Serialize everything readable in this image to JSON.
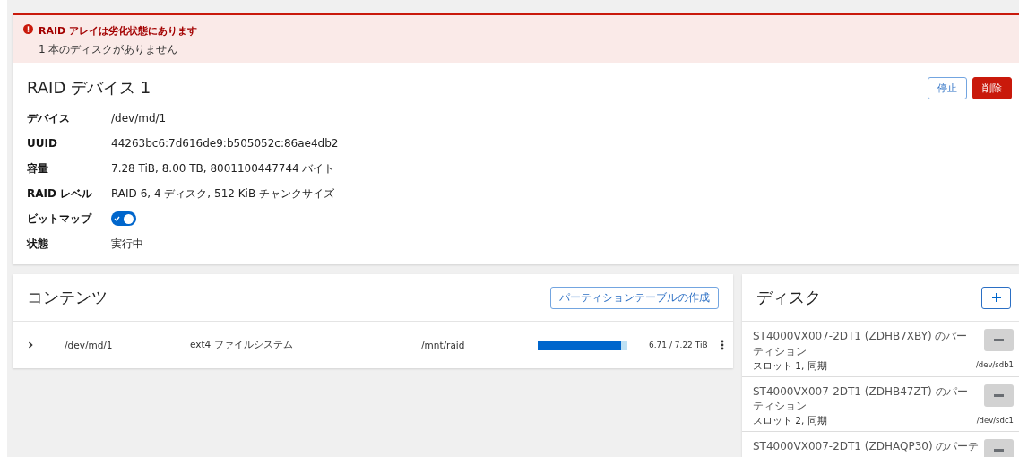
{
  "alert": {
    "title": "RAID アレイは劣化状態にあります",
    "message": "1 本のディスクがありません"
  },
  "device": {
    "title": "RAID デバイス 1",
    "actions": [
      {
        "label": "停止",
        "kind": "secondary"
      },
      {
        "label": "削除",
        "kind": "danger"
      }
    ],
    "fields": [
      {
        "label": "デバイス",
        "value": "/dev/md/1",
        "kind": "text"
      },
      {
        "label": "UUID",
        "value": "44263bc6:7d616de9:b505052c:86ae4db2",
        "kind": "text"
      },
      {
        "label": "容量",
        "value": "7.28 TiB, 8.00 TB, 8001100447744 バイト",
        "kind": "text"
      },
      {
        "label": "RAID レベル",
        "value": "RAID 6, 4 ディスク, 512 KiB チャンクサイズ",
        "kind": "text"
      },
      {
        "label": "ビットマップ",
        "on": true,
        "kind": "switch"
      },
      {
        "label": "状態",
        "value": "実行中",
        "kind": "text"
      }
    ]
  },
  "contents": {
    "title": "コンテンツ",
    "action": "パーティションテーブルの作成",
    "rows": [
      {
        "expanded": false,
        "device": "/dev/md/1",
        "filesystem": "ext4 ファイルシステム",
        "mount": "/mnt/raid",
        "level": 0.93,
        "usage": "6.71 / 7.22 TiB"
      }
    ]
  },
  "disks": {
    "title": "ディスク",
    "items": [
      {
        "name": "ST4000VX007-2DT1 (ZDHB7XBY) のパーティション",
        "detail": "スロット 1, 同期",
        "path": "/dev/sdb1"
      },
      {
        "name": "ST4000VX007-2DT1 (ZDHB47ZT) のパーティション",
        "detail": "スロット 2, 同期",
        "path": "/dev/sdc1"
      },
      {
        "name": "ST4000VX007-2DT1 (ZDHAQP30) のパーテ"
      }
    ]
  }
}
